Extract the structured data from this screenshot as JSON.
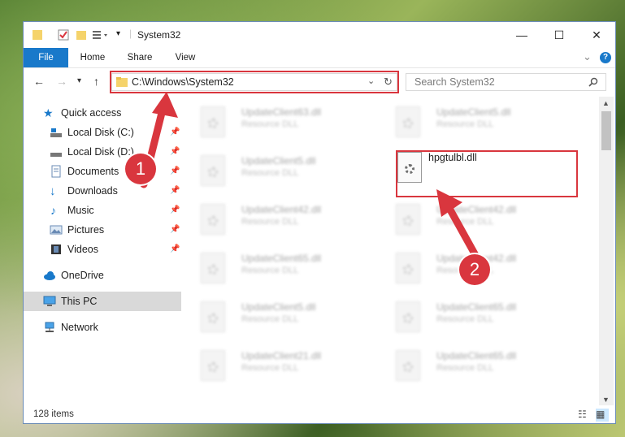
{
  "window": {
    "title": "System32",
    "controls": {
      "minimize": "—",
      "maximize": "☐",
      "close": "✕"
    }
  },
  "ribbon": {
    "tabs": [
      "File",
      "Home",
      "Share",
      "View"
    ],
    "collapse_icon": "⌄",
    "help_icon": "?"
  },
  "address": {
    "path": "C:\\Windows\\System32",
    "search_placeholder": "Search System32"
  },
  "nav": {
    "items": [
      {
        "label": "Quick access",
        "icon": "star-icon",
        "pinned": false
      },
      {
        "label": "Local Disk (C:)",
        "icon": "drive-icon",
        "pinned": true
      },
      {
        "label": "Local Disk (D:)",
        "icon": "drive-icon",
        "pinned": true
      },
      {
        "label": "Documents",
        "icon": "documents-icon",
        "pinned": true
      },
      {
        "label": "Downloads",
        "icon": "download-icon",
        "pinned": true
      },
      {
        "label": "Music",
        "icon": "music-icon",
        "pinned": true
      },
      {
        "label": "Pictures",
        "icon": "pictures-icon",
        "pinned": true
      },
      {
        "label": "Videos",
        "icon": "videos-icon",
        "pinned": true
      },
      {
        "label": "OneDrive",
        "icon": "cloud-icon",
        "pinned": false
      },
      {
        "label": "This PC",
        "icon": "computer-icon",
        "pinned": false,
        "selected": true
      },
      {
        "label": "Network",
        "icon": "network-icon",
        "pinned": false
      }
    ]
  },
  "files": {
    "left_column": [
      {
        "name": "UpdateClient63.dll",
        "type": "Resource DLL"
      },
      {
        "name": "UpdateClient5.dll",
        "type": "Resource DLL"
      },
      {
        "name": "UpdateClient42.dll",
        "type": "Resource DLL"
      },
      {
        "name": "UpdateClient65.dll",
        "type": "Resource DLL"
      },
      {
        "name": "UpdateClient5.dll",
        "type": "Resource DLL"
      },
      {
        "name": "UpdateClient21.dll",
        "type": "Resource DLL"
      }
    ],
    "right_column": [
      {
        "name": "UpdateClient5.dll",
        "type": "Resource DLL"
      },
      {
        "name": "hpgtulbl.dll",
        "type": "",
        "highlighted": true
      },
      {
        "name": "UpdateClient42.dll",
        "type": "Resource DLL"
      },
      {
        "name": "UpdateClient42.dll",
        "type": "Resource DLL"
      },
      {
        "name": "UpdateClient65.dll",
        "type": "Resource DLL"
      },
      {
        "name": "UpdateClient65.dll",
        "type": "Resource DLL"
      }
    ]
  },
  "status": {
    "item_count": "128 items"
  },
  "annotations": {
    "step1": "1",
    "step2": "2",
    "color": "#d9363e"
  }
}
